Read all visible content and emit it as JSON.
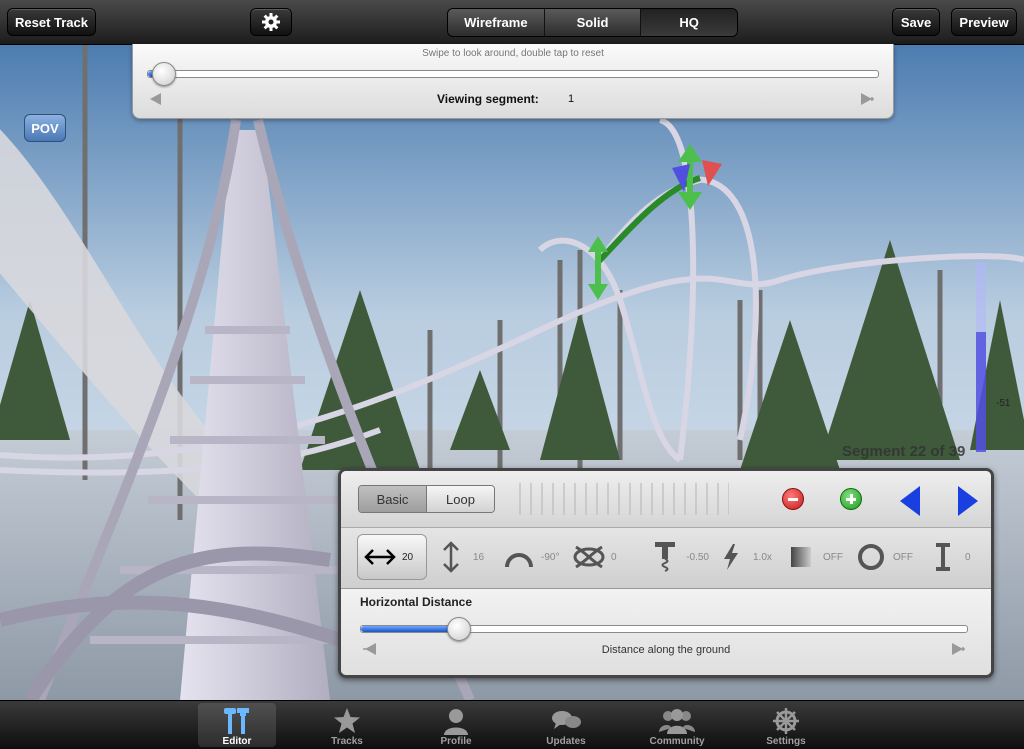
{
  "toolbar": {
    "reset_label": "Reset Track",
    "save_label": "Save",
    "preview_label": "Preview",
    "render_modes": [
      "Wireframe",
      "Solid",
      "HQ"
    ],
    "selected_mode": "HQ"
  },
  "view_panel": {
    "hint": "Swipe to look around, double tap to reset",
    "segment_label": "Viewing segment:",
    "segment_value": "1",
    "slider_position": 0.02
  },
  "pov_label": "POV",
  "segment_status": "Segment 22 of 39",
  "height_meter": {
    "value_label": "-51",
    "level": 0.63
  },
  "editor": {
    "mode_tabs": [
      "Basic",
      "Loop"
    ],
    "selected_tab": "Basic",
    "params": [
      {
        "icon": "horizontal-arrows-icon",
        "value": "20",
        "selected": true
      },
      {
        "icon": "vertical-arrows-icon",
        "value": "16"
      },
      {
        "icon": "curve-arch-icon",
        "value": "-90°"
      },
      {
        "icon": "roll-twist-icon",
        "value": "0"
      },
      {
        "icon": "bank-spring-icon",
        "value": "-0.50"
      },
      {
        "icon": "lightning-icon",
        "value": "1.0x"
      },
      {
        "icon": "gradient-square-icon",
        "value": "OFF"
      },
      {
        "icon": "circle-loop-icon",
        "value": "OFF"
      },
      {
        "icon": "support-pillar-icon",
        "value": "0"
      }
    ],
    "param_title": "Horizontal Distance",
    "param_desc": "Distance along the ground",
    "param_slider_position": 0.16
  },
  "tabbar": {
    "items": [
      {
        "label": "Editor",
        "icon": "tools-icon",
        "active": true
      },
      {
        "label": "Tracks",
        "icon": "star-icon"
      },
      {
        "label": "Profile",
        "icon": "person-icon"
      },
      {
        "label": "Updates",
        "icon": "speech-bubbles-icon"
      },
      {
        "label": "Community",
        "icon": "group-icon"
      },
      {
        "label": "Settings",
        "icon": "wheel-icon"
      }
    ]
  },
  "colors": {
    "accent_blue": "#1b54c9",
    "remove_red": "#d92020",
    "add_green": "#2aa52a",
    "arrow_blue": "#1a3fe0"
  }
}
